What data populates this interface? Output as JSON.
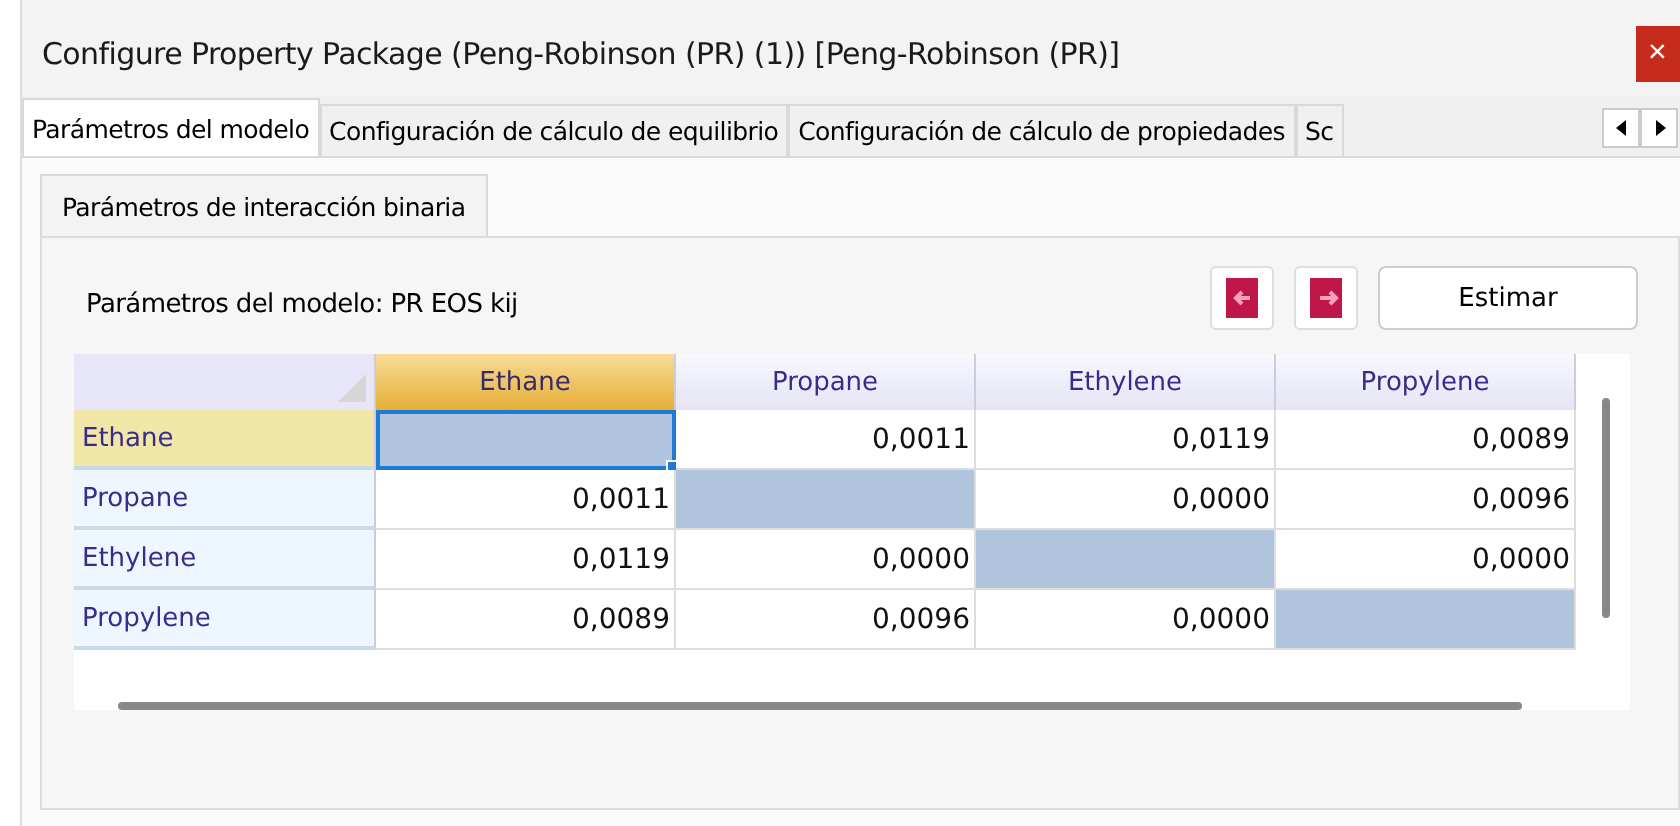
{
  "window": {
    "title": "Configure Property Package (Peng-Robinson (PR) (1)) [Peng-Robinson (PR)]",
    "close": "×"
  },
  "tabs": [
    {
      "label": "Parámetros del modelo",
      "selected": true
    },
    {
      "label": "Configuración de cálculo de equilibrio",
      "selected": false
    },
    {
      "label": "Configuración de cálculo de propiedades",
      "selected": false
    },
    {
      "label": "Sc",
      "selected": false
    }
  ],
  "subtabs": [
    {
      "label": "Parámetros de interacción binaria",
      "selected": true
    }
  ],
  "model_label": "Parámetros del modelo: PR EOS kij",
  "estimate_button": "Estimar",
  "grid": {
    "columns": [
      {
        "label": "Ethane",
        "selected": true
      },
      {
        "label": "Propane",
        "selected": false
      },
      {
        "label": "Ethylene",
        "selected": false
      },
      {
        "label": "Propylene",
        "selected": false
      }
    ],
    "rows": [
      {
        "name": "Ethane",
        "selected": true,
        "cells": [
          {
            "kind": "diagonal",
            "focused": true
          },
          {
            "kind": "value",
            "value": "0,0011",
            "focused": false
          },
          {
            "kind": "value",
            "value": "0,0119",
            "focused": false
          },
          {
            "kind": "value",
            "value": "0,0089",
            "focused": false
          }
        ]
      },
      {
        "name": "Propane",
        "selected": false,
        "cells": [
          {
            "kind": "value",
            "value": "0,0011",
            "focused": false
          },
          {
            "kind": "diagonal",
            "focused": false
          },
          {
            "kind": "value",
            "value": "0,0000",
            "focused": false
          },
          {
            "kind": "value",
            "value": "0,0096",
            "focused": false
          }
        ]
      },
      {
        "name": "Ethylene",
        "selected": false,
        "cells": [
          {
            "kind": "value",
            "value": "0,0119",
            "focused": false
          },
          {
            "kind": "value",
            "value": "0,0000",
            "focused": false
          },
          {
            "kind": "diagonal",
            "focused": false
          },
          {
            "kind": "value",
            "value": "0,0000",
            "focused": false
          }
        ]
      },
      {
        "name": "Propylene",
        "selected": false,
        "cells": [
          {
            "kind": "value",
            "value": "0,0089",
            "focused": false
          },
          {
            "kind": "value",
            "value": "0,0096",
            "focused": false
          },
          {
            "kind": "value",
            "value": "0,0000",
            "focused": false
          },
          {
            "kind": "diagonal",
            "focused": false
          }
        ]
      }
    ]
  }
}
